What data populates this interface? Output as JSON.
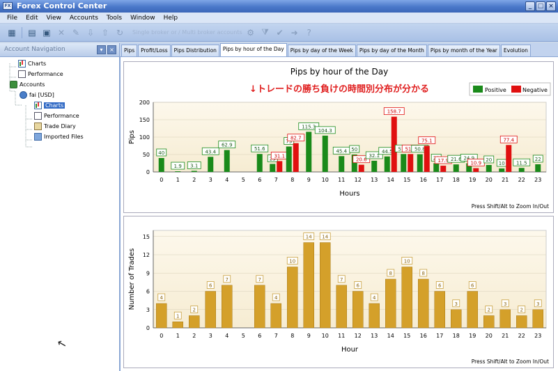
{
  "window": {
    "title": "Forex Control Center",
    "buttons": [
      "_",
      "□",
      "×"
    ]
  },
  "menu": [
    {
      "label": "File"
    },
    {
      "label": "Edit"
    },
    {
      "label": "View"
    },
    {
      "label": "Accounts"
    },
    {
      "label": "Tools"
    },
    {
      "label": "Window"
    },
    {
      "label": "Help"
    }
  ],
  "toolbar": {
    "ghost_text": "Single broker or / Multi broker accounts"
  },
  "sidebar": {
    "title": "Account Navigation",
    "items": [
      {
        "label": "Charts",
        "icon": "chart-icon"
      },
      {
        "label": "Performance",
        "icon": "document-icon"
      },
      {
        "label": "Accounts",
        "icon": "accounts-folder-icon"
      },
      {
        "label": "fai [USD]",
        "icon": "account-icon"
      },
      {
        "label": "Charts",
        "icon": "chart-icon",
        "selected": true
      },
      {
        "label": "Performance",
        "icon": "document-icon"
      },
      {
        "label": "Trade Diary",
        "icon": "diary-icon"
      },
      {
        "label": "Imported Files",
        "icon": "files-icon"
      }
    ]
  },
  "tabs": [
    {
      "label": "Pips"
    },
    {
      "label": "Profit/Loss"
    },
    {
      "label": "Pips Distribution"
    },
    {
      "label": "Pips by hour of the Day",
      "active": true
    },
    {
      "label": "Pips by day of the Week"
    },
    {
      "label": "Pips by day of the Month"
    },
    {
      "label": "Pips by month of the Year"
    },
    {
      "label": "Evolution"
    }
  ],
  "colors": {
    "positive": "#1a8a1a",
    "negative": "#e01010",
    "trades": "#d4a02a",
    "annotation": "#e02020",
    "plot_bg": "#f6ecd2"
  },
  "chart_data": [
    {
      "type": "bar",
      "title": "Pips by hour of the Day",
      "annotation": "↓トレードの勝ち負けの時間別分布が分かる",
      "xlabel": "Hours",
      "ylabel": "Pips",
      "ylim": [
        0,
        200
      ],
      "yticks": [
        0,
        50,
        100,
        150,
        200
      ],
      "categories": [
        "0",
        "1",
        "2",
        "3",
        "4",
        "5",
        "6",
        "7",
        "8",
        "9",
        "10",
        "11",
        "12",
        "13",
        "14",
        "15",
        "16",
        "17",
        "18",
        "19",
        "20",
        "21",
        "22",
        "23"
      ],
      "legend_position": "top-right",
      "series": [
        {
          "name": "Positive",
          "values": [
            40,
            1.9,
            3.1,
            43.4,
            62.9,
            null,
            51.6,
            23,
            73,
            115.3,
            104.3,
            45.4,
            50,
            32.1,
            44.5,
            51.4,
            50.8,
            25,
            21.6,
            24.9,
            20,
            10,
            11.5,
            22
          ]
        },
        {
          "name": "Negative",
          "values": [
            null,
            null,
            null,
            null,
            null,
            null,
            null,
            31.1,
            82.7,
            null,
            null,
            null,
            20.6,
            null,
            158.7,
            51.4,
            75.1,
            17.9,
            null,
            10.9,
            null,
            77.4,
            null,
            null
          ]
        }
      ],
      "data_labels": {
        "positive": [
          "40",
          "1.9",
          "3.1",
          "43.4",
          "62.9",
          "",
          "51.6",
          "23",
          "73",
          "115.3",
          "104.3",
          "45.4",
          "50",
          "32.1",
          "44.5",
          "51.4",
          "50.8",
          "25",
          "21.6",
          "24.9",
          "20",
          "10",
          "11.5",
          "22"
        ],
        "negative": [
          "",
          "",
          "",
          "",
          "",
          "",
          "",
          "31.1",
          "82.7",
          "",
          "",
          "",
          "20.6",
          "",
          "158.7",
          "51.4",
          "75.1",
          "17.9",
          "",
          "10.9",
          "",
          "77.4",
          "",
          ""
        ]
      },
      "footer": "Press Shift/Alt to Zoom In/Out"
    },
    {
      "type": "bar",
      "xlabel": "Hour",
      "ylabel": "Number of Trades",
      "ylim": [
        0,
        16
      ],
      "yticks": [
        0,
        3,
        6,
        9,
        12,
        15
      ],
      "categories": [
        "0",
        "1",
        "2",
        "3",
        "4",
        "5",
        "6",
        "7",
        "8",
        "9",
        "10",
        "11",
        "12",
        "13",
        "14",
        "15",
        "16",
        "17",
        "18",
        "19",
        "20",
        "21",
        "22",
        "23"
      ],
      "values": [
        4,
        1,
        2,
        6,
        7,
        0,
        7,
        4,
        10,
        14,
        14,
        7,
        6,
        4,
        8,
        10,
        8,
        6,
        3,
        6,
        2,
        3,
        2,
        3
      ],
      "data_labels": [
        "4",
        "1",
        "2",
        "6",
        "7",
        "",
        "7",
        "4",
        "10",
        "14",
        "14",
        "7",
        "6",
        "4",
        "8",
        "10",
        "8",
        "6",
        "3",
        "6",
        "2",
        "3",
        "2",
        "3"
      ],
      "footer": "Press Shift/Alt to Zoom In/Out"
    }
  ]
}
